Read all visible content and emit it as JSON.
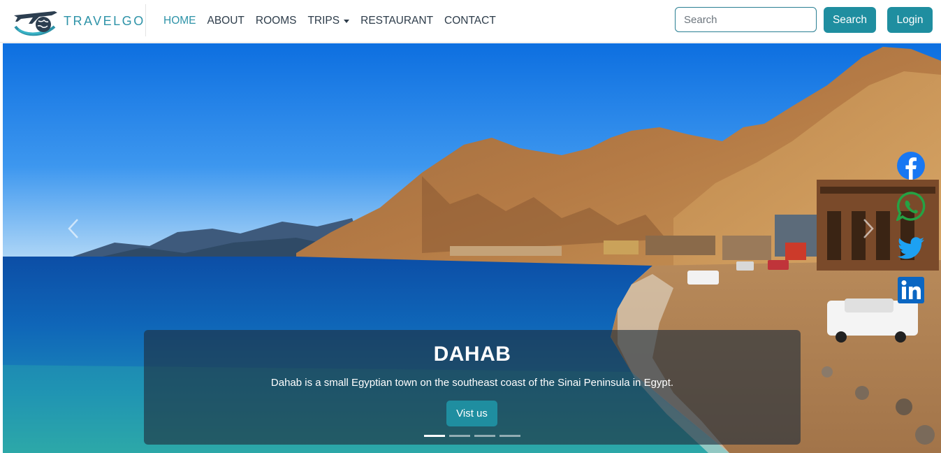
{
  "brand": {
    "name": "TRAVELGO",
    "logo_icon": "plane-globe-logo-icon"
  },
  "nav": {
    "items": [
      {
        "label": "HOME",
        "active": true
      },
      {
        "label": "ABOUT",
        "active": false
      },
      {
        "label": "ROOMS",
        "active": false
      },
      {
        "label": "TRIPS",
        "active": false,
        "dropdown": true
      },
      {
        "label": "RESTAURANT",
        "active": false
      },
      {
        "label": "CONTACT",
        "active": false
      }
    ]
  },
  "search": {
    "placeholder": "Search",
    "value": "",
    "button_label": "Search"
  },
  "login": {
    "label": "Login"
  },
  "hero": {
    "title": "DAHAB",
    "text": "Dahab is a small Egyptian town on the southeast coast of the Sinai Peninsula in Egypt.",
    "button_label": "Vist us",
    "slides_count": 4,
    "active_slide": 1
  },
  "social": [
    "facebook-icon",
    "whatsapp-icon",
    "twitter-icon",
    "linkedin-icon"
  ],
  "colors": {
    "accent": "#1f8ea0",
    "brand_text": "#2e93a8",
    "nav_text": "#2d3c4a",
    "facebook": "#1877f2",
    "whatsapp": "#25a244",
    "twitter": "#1da1f2",
    "linkedin": "#0a66c2"
  }
}
